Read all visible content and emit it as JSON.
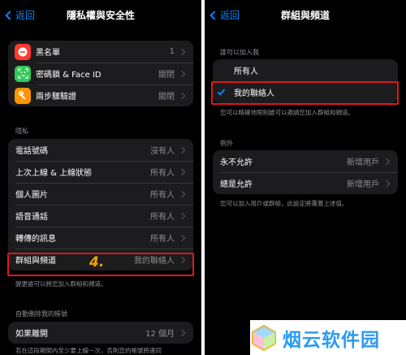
{
  "left": {
    "back_label": "返回",
    "title": "隱私權與安全性",
    "top_group": [
      {
        "label": "黑名單",
        "value": "1",
        "icon": "minus-circle-icon",
        "color": "#ff3b30"
      },
      {
        "label": "密碼鎖 & Face ID",
        "value": "關閉",
        "icon": "face-id-icon",
        "color": "#34c759"
      },
      {
        "label": "兩步驟驗證",
        "value": "關閉",
        "icon": "key-icon",
        "color": "#ff9500"
      }
    ],
    "privacy_header": "隱私",
    "privacy_items": [
      {
        "label": "電話號碼",
        "value": "沒有人"
      },
      {
        "label": "上次上線 & 上線狀態",
        "value": "所有人"
      },
      {
        "label": "個人圖片",
        "value": "所有人"
      },
      {
        "label": "語音通話",
        "value": "所有人"
      },
      {
        "label": "轉傳的訊息",
        "value": "所有人"
      },
      {
        "label": "群組與頻道",
        "value": "我的聯絡人"
      }
    ],
    "step_marker": "4.",
    "privacy_footer": "變更誰可以將您加入群組和頻道。",
    "auto_delete_header": "自動刪除我的帳號",
    "auto_delete_item": {
      "label": "如果離開",
      "value": "12 個月"
    },
    "auto_delete_footer": "若在這段期間內至少要上線一次，否則您的帳號將連同"
  },
  "right": {
    "back_label": "返回",
    "title": "群組與頻道",
    "who_header": "誰可以加入我",
    "options": [
      {
        "label": "所有人",
        "selected": false
      },
      {
        "label": "我的聯絡人",
        "selected": true
      }
    ],
    "options_footer": "您可以精確地限制誰可以邀請您加入群組和頻道。",
    "exceptions_header": "例外",
    "exceptions": [
      {
        "label": "永不允許",
        "value": "新增用戶"
      },
      {
        "label": "總是允許",
        "value": "新增用戶"
      }
    ],
    "exceptions_footer": "您可以加入用戶或群組，此設定將覆蓋上述值。"
  },
  "watermark": {
    "text": "烟云软件园"
  },
  "colors": {
    "accent": "#0a84ff",
    "highlight": "#e0161b",
    "step": "#f0a000",
    "watermark": "#2e9af0"
  }
}
